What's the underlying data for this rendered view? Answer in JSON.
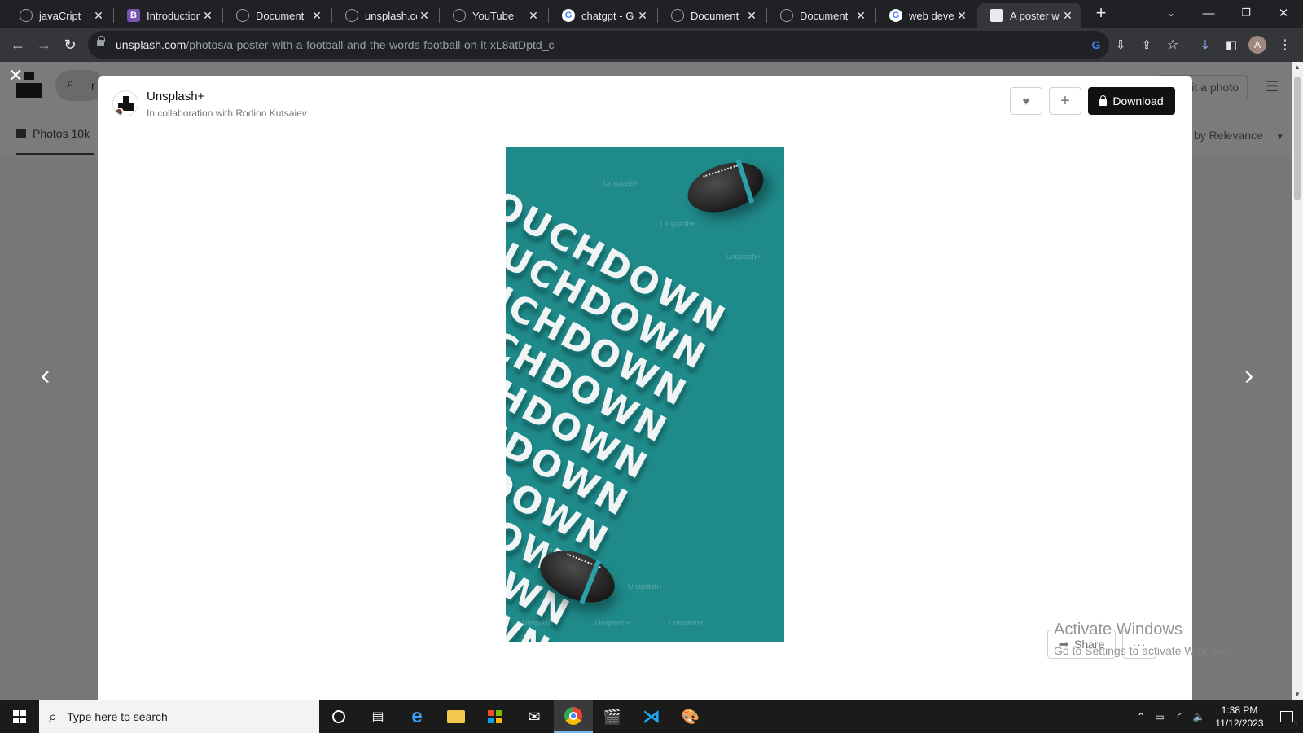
{
  "browser": {
    "tabs": [
      {
        "title": "javaCript",
        "favicon": "globe-icon"
      },
      {
        "title": "Introduction",
        "favicon": "bootstrap-icon"
      },
      {
        "title": "Document",
        "favicon": "globe-icon"
      },
      {
        "title": "unsplash.co",
        "favicon": "globe-icon"
      },
      {
        "title": "YouTube",
        "favicon": "globe-icon"
      },
      {
        "title": "chatgpt - G",
        "favicon": "google-icon"
      },
      {
        "title": "Document",
        "favicon": "globe-icon"
      },
      {
        "title": "Document",
        "favicon": "globe-icon"
      },
      {
        "title": "web develo",
        "favicon": "google-icon"
      },
      {
        "title": "A poster wit",
        "favicon": "unsplash-icon",
        "active": true
      }
    ],
    "url_host": "unsplash.com",
    "url_path": "/photos/a-poster-with-a-football-and-the-words-football-on-it-xL8atDptd_c",
    "profile_initial": "A"
  },
  "background_page": {
    "search_initial": "r",
    "photos_tab": "Photos 10k",
    "submit_label": "it a photo",
    "sort_label": "by Relevance"
  },
  "modal": {
    "author": "Unsplash+",
    "collaboration": "In collaboration with Rodion Kutsaiev",
    "download_label": "Download",
    "share_label": "Share",
    "more_label": "···",
    "poster_word": "TOUCHDOWN",
    "watermark": "Unsplash+",
    "prev_arrow": "‹",
    "next_arrow": "›"
  },
  "watermark_os": {
    "title": "Activate Windows",
    "subtitle": "Go to Settings to activate Windows."
  },
  "taskbar": {
    "search_placeholder": "Type here to search",
    "time": "1:38 PM",
    "date": "11/12/2023",
    "notification_count": "1"
  },
  "colors": {
    "poster_teal": "#1f8a8a",
    "download_button": "#111111",
    "chrome_dark": "#202124"
  }
}
